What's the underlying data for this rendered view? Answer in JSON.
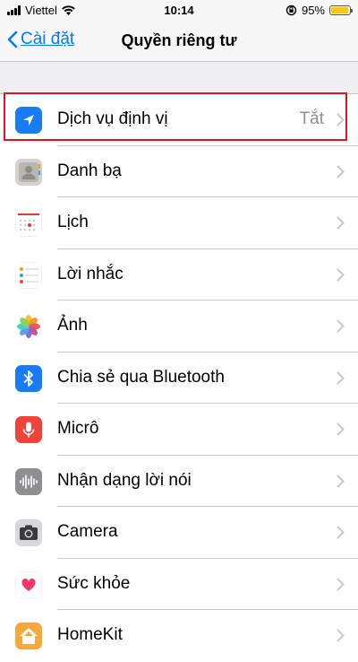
{
  "status": {
    "carrier": "Viettel",
    "time": "10:14",
    "battery": "95%",
    "battery_level": 0.95
  },
  "nav": {
    "back_label": "Cài đặt",
    "title": "Quyền riêng tư"
  },
  "rows": [
    {
      "label": "Dịch vụ định vị",
      "value": "Tắt",
      "icon": "location-arrow-icon",
      "color": "#1a7cf5"
    },
    {
      "label": "Danh bạ",
      "value": "",
      "icon": "contacts-icon",
      "color": "#c7c7cc"
    },
    {
      "label": "Lịch",
      "value": "",
      "icon": "calendar-icon",
      "color": "#ffffff"
    },
    {
      "label": "Lời nhắc",
      "value": "",
      "icon": "reminders-icon",
      "color": "#ffffff"
    },
    {
      "label": "Ảnh",
      "value": "",
      "icon": "photos-icon",
      "color": "#ffffff"
    },
    {
      "label": "Chia sẻ qua Bluetooth",
      "value": "",
      "icon": "bluetooth-icon",
      "color": "#1a7cf5"
    },
    {
      "label": "Micrô",
      "value": "",
      "icon": "microphone-icon",
      "color": "#f0433a"
    },
    {
      "label": "Nhận dạng lời nói",
      "value": "",
      "icon": "speech-waveform-icon",
      "color": "#8e8e93"
    },
    {
      "label": "Camera",
      "value": "",
      "icon": "camera-icon",
      "color": "#d1d1d6"
    },
    {
      "label": "Sức khỏe",
      "value": "",
      "icon": "health-heart-icon",
      "color": "#ffffff"
    },
    {
      "label": "HomeKit",
      "value": "",
      "icon": "home-icon",
      "color": "#f29d38"
    }
  ]
}
